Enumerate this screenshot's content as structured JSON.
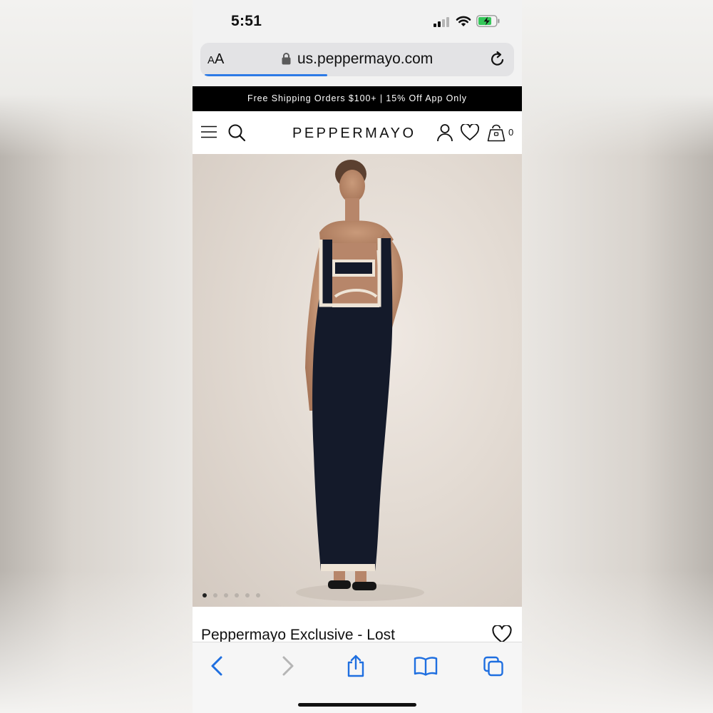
{
  "status_bar": {
    "time": "5:51",
    "signal_icon": "signal-bars-icon",
    "wifi_icon": "wifi-icon",
    "battery_icon": "battery-charging-icon"
  },
  "browser": {
    "text_size_label_small": "A",
    "text_size_label_large": "A",
    "url": "us.peppermayo.com",
    "lock_icon": "lock-icon",
    "reload_icon": "reload-icon",
    "load_progress": 0.39,
    "accent_color": "#2c7ae6"
  },
  "promo_banner": {
    "text": "Free Shipping Orders $100+ | 15% Off App Only"
  },
  "site_header": {
    "logo": "PEPPERMAYO",
    "menu_icon": "hamburger-menu-icon",
    "search_icon": "search-icon",
    "account_icon": "user-icon",
    "wishlist_icon": "heart-icon",
    "cart_icon": "shopping-bag-icon",
    "cart_count": "0"
  },
  "product": {
    "image_alt": "model-in-black-maxi-dress",
    "carousel": {
      "total": 6,
      "active": 1
    },
    "title": "Peppermayo Exclusive - Lost",
    "wishlist_icon": "heart-outline-icon"
  },
  "safari_toolbar": {
    "back_icon": "chevron-left-icon",
    "forward_icon": "chevron-right-icon",
    "share_icon": "share-icon",
    "bookmarks_icon": "book-icon",
    "tabs_icon": "tabs-icon"
  }
}
